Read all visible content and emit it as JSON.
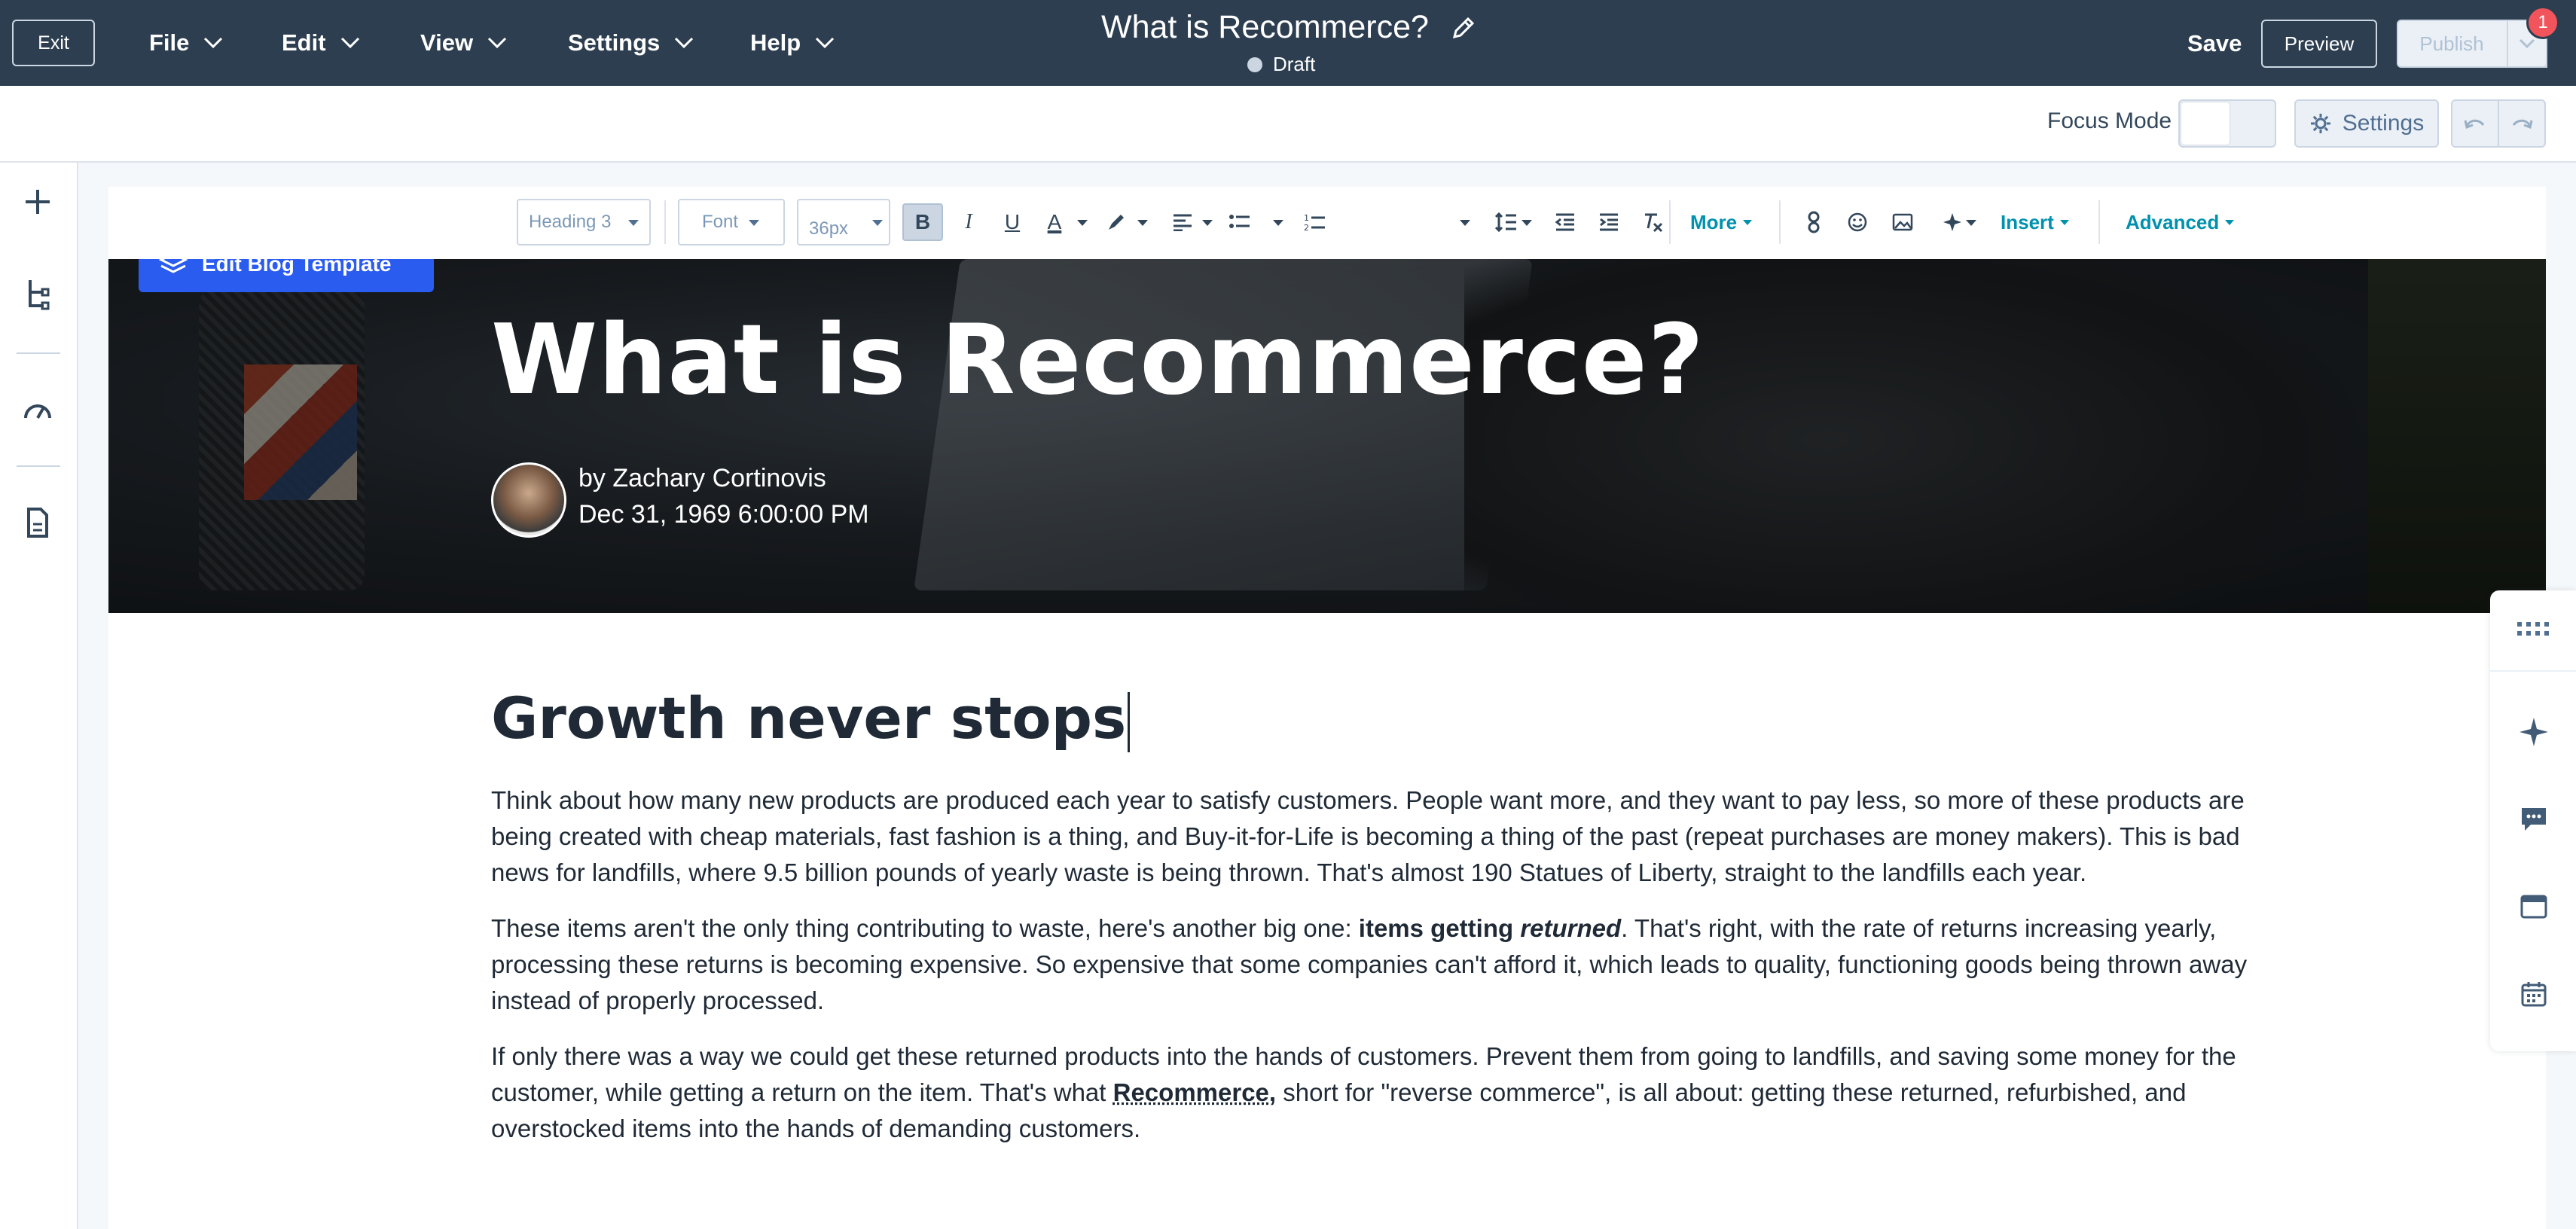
{
  "topbar": {
    "exit_label": "Exit",
    "menus": [
      {
        "label": "File"
      },
      {
        "label": "Edit"
      },
      {
        "label": "View"
      },
      {
        "label": "Settings"
      },
      {
        "label": "Help"
      }
    ],
    "doc_title": "What is Recommerce?",
    "status": "Draft",
    "save_label": "Save",
    "preview_label": "Preview",
    "publish_label": "Publish",
    "notification_count": "1"
  },
  "subbar": {
    "focus_mode_label": "Focus Mode",
    "settings_label": "Settings"
  },
  "toolbar": {
    "block_style": "Heading 3",
    "font": "Font",
    "font_size": "36px",
    "bold": "B",
    "italic": "I",
    "underline": "U",
    "text_color": "A",
    "more_label": "More",
    "insert_label": "Insert",
    "advanced_label": "Advanced"
  },
  "hero": {
    "edit_template_label": "Edit Blog Template",
    "title": "What is Recommerce?",
    "author": "by Zachary Cortinovis",
    "date": "Dec 31, 1969 6:00:00 PM"
  },
  "post": {
    "heading": "Growth never stops",
    "p1": "Think about how many new products are produced each year to satisfy customers. People want more, and they want to pay less, so more of these products are being created with cheap materials, fast fashion is a thing, and Buy-it-for-Life is becoming a thing of the past (repeat purchases are money makers). This is bad news for landfills, where 9.5 billion pounds of yearly waste is being thrown. That's almost 190 Statues of Liberty, straight to the landfills each year.",
    "p2_a": "These items aren't the only thing contributing to waste, here's another big one: ",
    "p2_b": "items getting ",
    "p2_c": "returned",
    "p2_d": ". That's right, with the rate of returns increasing yearly, processing these returns is becoming expensive. So expensive that some companies can't afford it, which leads to quality, functioning goods being thrown away instead of properly processed.",
    "p3_a": "If only there was a way we could get these returned products into the hands of customers. Prevent them from going to landfills, and saving some money for the customer, while getting a return on the item. That's what ",
    "p3_b": "Recommerce,",
    "p3_c": " short for \"reverse commerce\", is all about: getting these returned, refurbished, and overstocked items into the hands of demanding customers."
  },
  "icons": {
    "left_rail": [
      "plus-icon",
      "tree-icon",
      "gauge-icon",
      "file-icon"
    ],
    "right_rail": [
      "grid-icon",
      "sparkle-icon",
      "chat-icon",
      "browser-icon",
      "calendar-icon"
    ]
  },
  "colors": {
    "topbar_bg": "#2d3e50",
    "accent": "#0091ae",
    "template_button": "#2b5cf0",
    "badge": "#f2545b"
  }
}
